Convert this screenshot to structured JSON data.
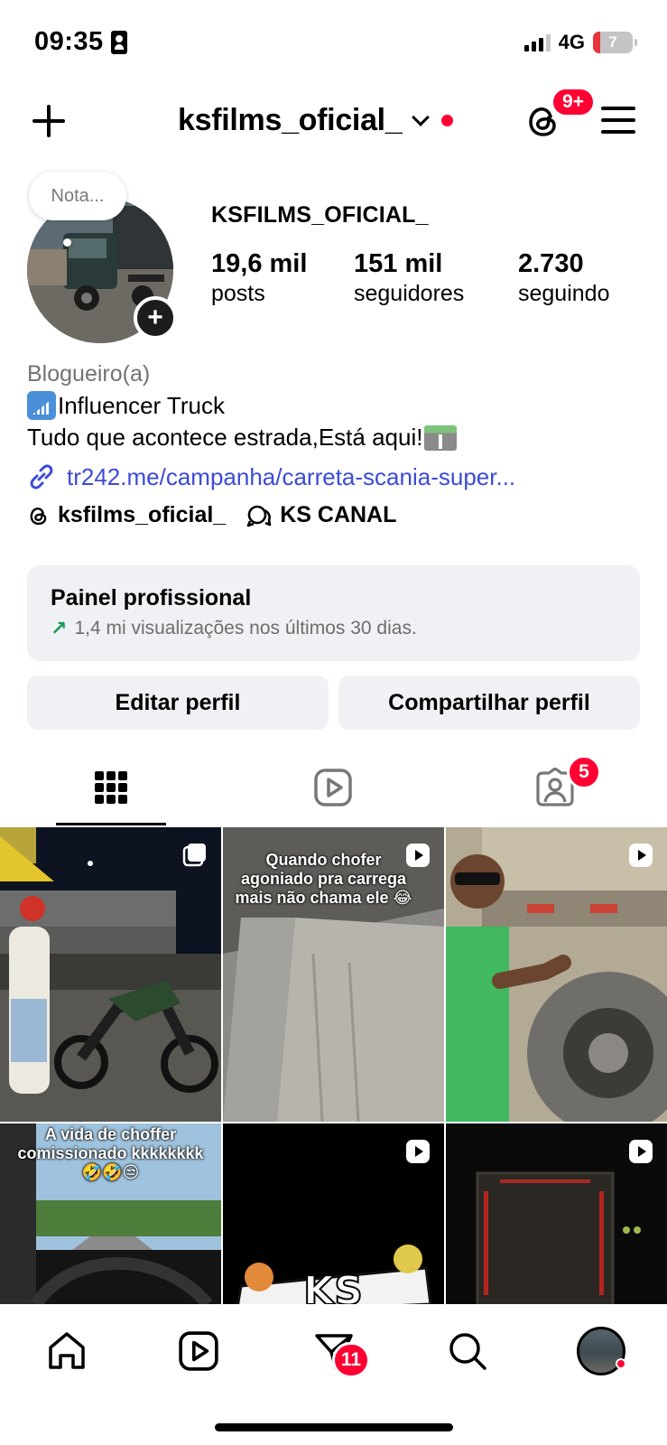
{
  "status_bar": {
    "time": "09:35",
    "network": "4G",
    "battery": "7"
  },
  "header": {
    "username": "ksfilms_oficial_",
    "threads_badge": "9+"
  },
  "profile": {
    "note_placeholder": "Nota...",
    "display_name": "KSFILMS_OFICIAL_",
    "stats": [
      {
        "value": "19,6 mil",
        "label": "posts"
      },
      {
        "value": "151 mil",
        "label": "seguidores"
      },
      {
        "value": "2.730",
        "label": "seguindo"
      }
    ],
    "category": "Blogueiro(a)",
    "bio_line1": "Influencer Truck",
    "bio_line2": "Tudo que acontece estrada,Está aqui!",
    "link": "tr242.me/campanha/carreta-scania-super...",
    "threads_handle": "ksfilms_oficial_",
    "channel_name": "KS CANAL"
  },
  "professional_panel": {
    "title": "Painel profissional",
    "subtitle": "1,4 mi visualizações nos últimos 30 dias."
  },
  "actions": {
    "edit_profile": "Editar perfil",
    "share_profile": "Compartilhar perfil"
  },
  "tabs": {
    "tagged_badge": "5"
  },
  "posts": [
    {
      "caption": "",
      "type": "carousel"
    },
    {
      "caption": "Quando chofer agoniado pra carrega mais não chama ele 😂",
      "type": "reel"
    },
    {
      "caption": "",
      "type": "reel"
    },
    {
      "caption": "A vida de choffer comissionado kkkkkkkk 🤣🤣😒",
      "type": "reel"
    },
    {
      "caption": "",
      "type": "reel"
    },
    {
      "caption": "",
      "type": "reel"
    }
  ],
  "bottom_nav": {
    "messages_badge": "11"
  },
  "colors": {
    "badge_red": "#ff0033",
    "link_blue": "#3b4bd8",
    "panel_bg": "#eff1f4",
    "trend_green": "#1a9b57"
  }
}
